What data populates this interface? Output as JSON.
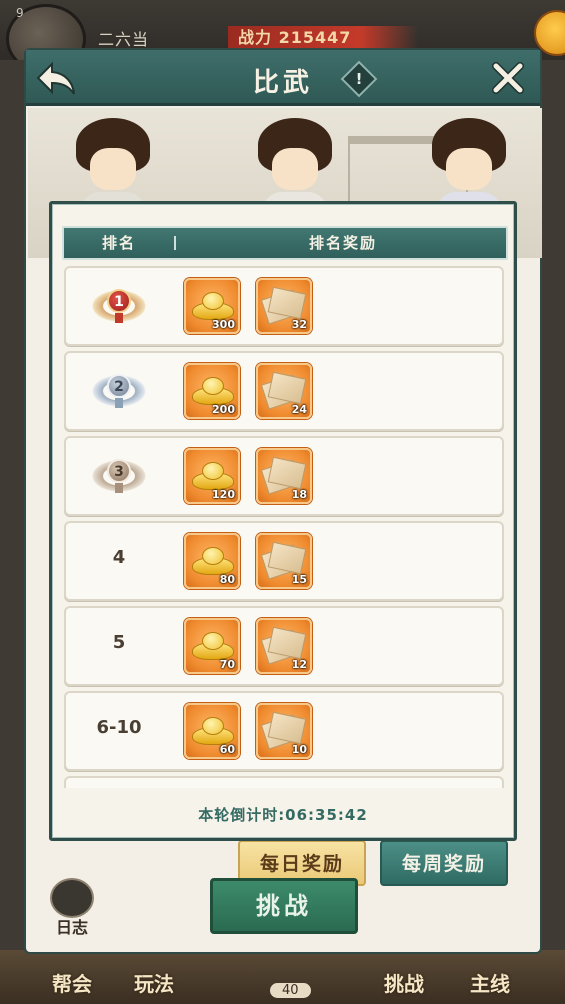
{
  "hud": {
    "level": "9",
    "player_name": "二六当",
    "power_label": "战力 215447"
  },
  "panel": {
    "title": "比武",
    "info_icon": "info-icon",
    "back_icon": "back-arrow-icon",
    "close_icon": "close-icon"
  },
  "modal": {
    "header": {
      "rank": "排名",
      "reward": "排名奖励"
    },
    "rows": [
      {
        "rank": "1",
        "medal": "gold",
        "ingots": "300",
        "scrolls": "32"
      },
      {
        "rank": "2",
        "medal": "silver",
        "ingots": "200",
        "scrolls": "24"
      },
      {
        "rank": "3",
        "medal": "bronze",
        "ingots": "120",
        "scrolls": "18"
      },
      {
        "rank": "4",
        "medal": "",
        "ingots": "80",
        "scrolls": "15"
      },
      {
        "rank": "5",
        "medal": "",
        "ingots": "70",
        "scrolls": "12"
      },
      {
        "rank": "6-10",
        "medal": "",
        "ingots": "60",
        "scrolls": "10"
      }
    ],
    "countdown": "本轮倒计时:06:35:42"
  },
  "tabs": {
    "daily": "每日奖励",
    "weekly": "每周奖励"
  },
  "actions": {
    "challenge": "挑战",
    "log": "日志"
  },
  "bottom_nav": {
    "guild": "帮会",
    "play": "玩法",
    "count": "40",
    "battle": "挑战",
    "main": "主线"
  },
  "colors": {
    "header_teal": "#30605b",
    "item_orange": "#ef8a2e",
    "countdown": "#356a63"
  }
}
